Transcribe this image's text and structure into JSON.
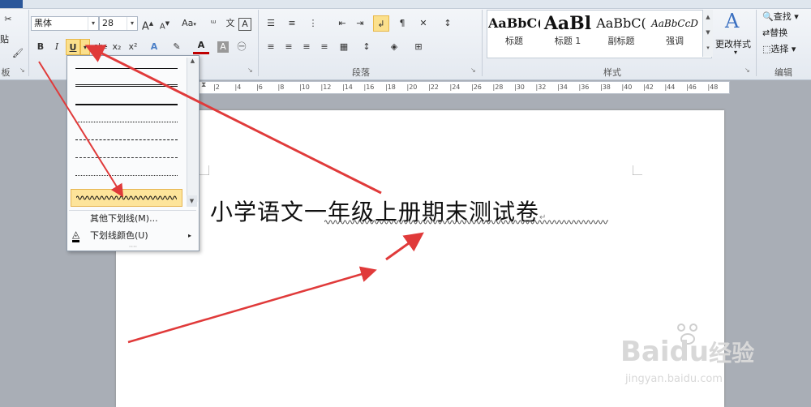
{
  "ribbon": {
    "font": {
      "font_name": "黑体",
      "font_size": "28",
      "group_label": "",
      "buttons": {
        "bold": "B",
        "italic": "I",
        "underline": "U",
        "strike": "abc",
        "subscript": "x₂",
        "superscript": "x²",
        "grow": "A",
        "shrink": "A",
        "change_case": "Aa",
        "clear": "A"
      }
    },
    "paragraph": {
      "group_label": "段落"
    },
    "styles": {
      "group_label": "样式",
      "items": [
        {
          "preview": "AaBbC(",
          "name": "标题"
        },
        {
          "preview": "AaBl",
          "name": "标题 1"
        },
        {
          "preview": "AaBbC(",
          "name": "副标题"
        },
        {
          "preview": "AaBbCcD",
          "name": "强调"
        }
      ],
      "change_styles": "更改样式"
    },
    "editing": {
      "group_label": "编辑",
      "find": "查找",
      "replace": "替换",
      "select": "选择"
    },
    "clipboard": {
      "group_label": "板",
      "paste": "贴"
    }
  },
  "ruler": {
    "ticks": [
      "2",
      "4",
      "6",
      "8",
      "10",
      "12",
      "14",
      "16",
      "18",
      "20",
      "22",
      "24",
      "26",
      "28",
      "30",
      "32",
      "34",
      "36",
      "38",
      "40",
      "42",
      "44",
      "46",
      "48"
    ]
  },
  "underline_menu": {
    "more_underlines": "其他下划线(M)...",
    "underline_color": "下划线颜色(U)"
  },
  "document": {
    "title": "小学语文一年级上册期末测试卷",
    "paragraph_mark": "↵"
  },
  "watermark": {
    "brand": "Baidu",
    "brand_cn": "经验",
    "url": "jingyan.baidu.com"
  },
  "colors": {
    "accent": "#2b579a",
    "arrow": "#e03a3a",
    "highlight": "#fde49a",
    "font_color": "#c00000"
  }
}
